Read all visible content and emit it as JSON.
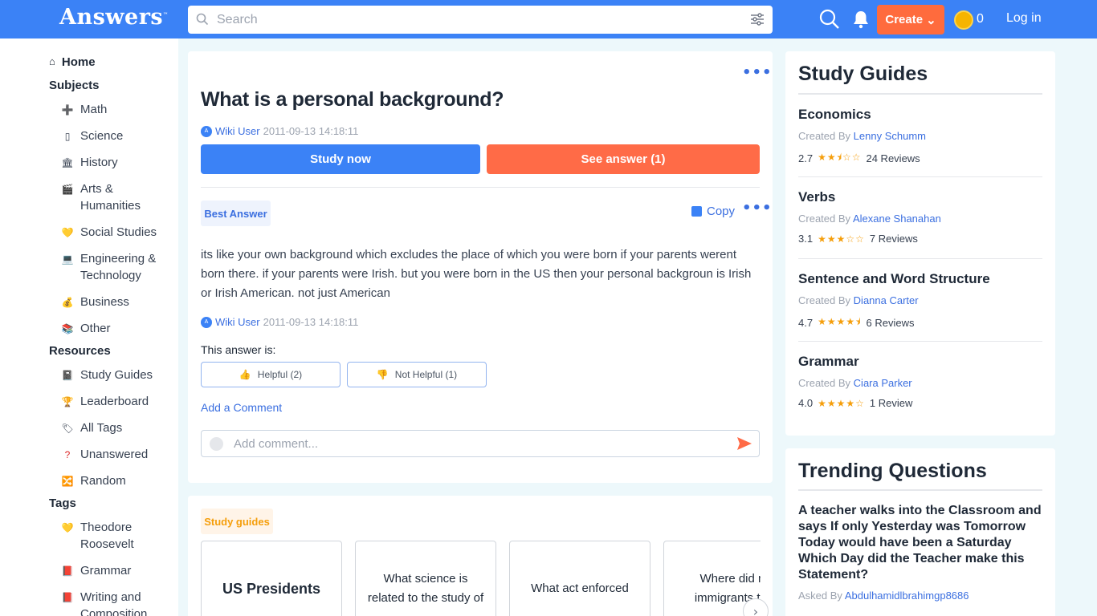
{
  "header": {
    "logo": "Answers",
    "logo_tm": "™",
    "search_placeholder": "Search",
    "create_label": "Create",
    "coins": "0",
    "login_label": "Log in"
  },
  "sidebar": {
    "home": "Home",
    "subjects_heading": "Subjects",
    "subjects": [
      "Math",
      "Science",
      "History",
      "Arts & Humanities",
      "Social Studies",
      "Engineering & Technology",
      "Business",
      "Other"
    ],
    "resources_heading": "Resources",
    "resources": [
      "Study Guides",
      "Leaderboard",
      "All Tags",
      "Unanswered",
      "Random"
    ],
    "tags_heading": "Tags",
    "tags": [
      "Theodore Roosevelt",
      "Grammar",
      "Writing and Composition"
    ]
  },
  "question": {
    "title": "What is a personal background?",
    "user": "Wiki User",
    "date": "2011-09-13 14:18:11",
    "study_now": "Study now",
    "see_answer": "See answer (1)"
  },
  "answer": {
    "badge": "Best Answer",
    "copy_label": "Copy",
    "text": "its like your own background which excludes the place of which you were born if your parents werent born there. if your parents were Irish. but you were born in the US then your personal backgroun is Irish or Irish American. not just American",
    "user": "Wiki User",
    "date": "2011-09-13 14:18:11",
    "rating_prompt": "This answer is:",
    "helpful": "Helpful (2)",
    "not_helpful": "Not Helpful (1)",
    "add_comment_link": "Add a Comment",
    "comment_placeholder": "Add comment..."
  },
  "study_guides_carousel": {
    "badge": "Study guides",
    "cards": [
      "US Presidents",
      "What science is related to the study of",
      "What act enforced",
      "Where did m immigrants to t"
    ]
  },
  "study_guides_panel": {
    "title": "Study Guides",
    "created_by": "Created By",
    "guides": [
      {
        "title": "Economics",
        "author": "Lenny Schumm",
        "rating": "2.7",
        "stars": "★★⯨☆☆",
        "reviews": "24 Reviews"
      },
      {
        "title": "Verbs",
        "author": "Alexane Shanahan",
        "rating": "3.1",
        "stars": "★★★☆☆",
        "reviews": "7 Reviews"
      },
      {
        "title": "Sentence and Word Structure",
        "author": "Dianna Carter",
        "rating": "4.7",
        "stars": "★★★★⯨",
        "reviews": "6 Reviews"
      },
      {
        "title": "Grammar",
        "author": "Ciara Parker",
        "rating": "4.0",
        "stars": "★★★★☆",
        "reviews": "1 Review"
      }
    ]
  },
  "trending": {
    "title": "Trending Questions",
    "question": "A teacher walks into the Classroom and says If only Yesterday was Tomorrow Today would have been a Saturday Which Day did the Teacher make this Statement?",
    "asked_by": "Asked By",
    "asker": "Abdulhamidlbrahimgp8686"
  },
  "colors": {
    "brand_blue": "#3b82f6",
    "accent_orange": "#ff6b47",
    "background": "#edf8fb"
  }
}
